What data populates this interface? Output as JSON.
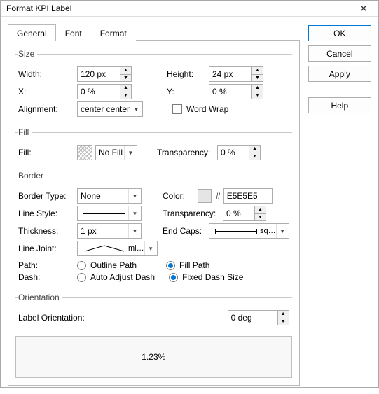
{
  "window": {
    "title": "Format KPI Label"
  },
  "tabs": {
    "general": "General",
    "font": "Font",
    "format": "Format"
  },
  "size": {
    "legend": "Size",
    "width_label": "Width:",
    "width_value": "120 px",
    "height_label": "Height:",
    "height_value": "24 px",
    "x_label": "X:",
    "x_value": "0 %",
    "y_label": "Y:",
    "y_value": "0 %",
    "alignment_label": "Alignment:",
    "alignment_value": "center center",
    "wordwrap_label": "Word Wrap"
  },
  "fill": {
    "legend": "Fill",
    "fill_label": "Fill:",
    "nofill": "No Fill",
    "transparency_label": "Transparency:",
    "transparency_value": "0 %"
  },
  "border": {
    "legend": "Border",
    "bordertype_label": "Border Type:",
    "bordertype_value": "None",
    "color_label": "Color:",
    "color_hash": "#",
    "color_value": "E5E5E5",
    "linestyle_label": "Line Style:",
    "transparency_label": "Transparency:",
    "transparency_value": "0 %",
    "thickness_label": "Thickness:",
    "thickness_value": "1 px",
    "endcaps_label": "End Caps:",
    "endcaps_text": "sq…",
    "linejoint_label": "Line Joint:",
    "linejoint_text": "mi…",
    "path_label": "Path:",
    "path_outline": "Outline Path",
    "path_fill": "Fill Path",
    "dash_label": "Dash:",
    "dash_auto": "Auto Adjust Dash",
    "dash_fixed": "Fixed Dash Size"
  },
  "orientation": {
    "legend": "Orientation",
    "label": "Label Orientation:",
    "value": "0 deg"
  },
  "preview": {
    "text": "1.23%"
  },
  "buttons": {
    "ok": "OK",
    "cancel": "Cancel",
    "apply": "Apply",
    "help": "Help"
  }
}
